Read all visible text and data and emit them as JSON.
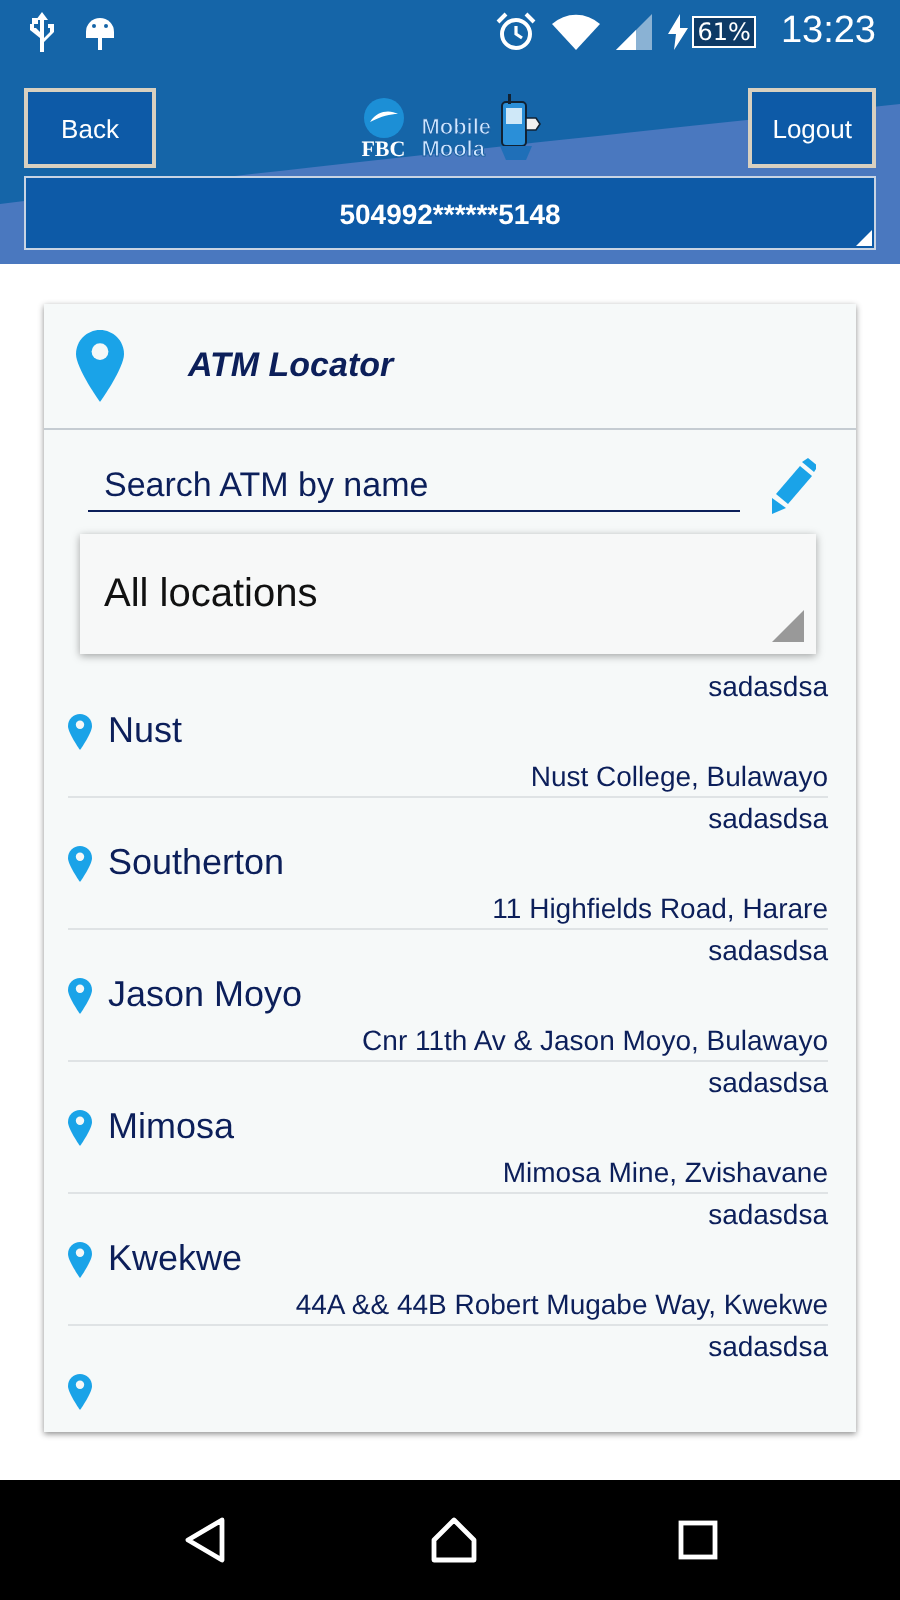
{
  "status_bar": {
    "battery": "61%",
    "time": "13:23"
  },
  "header": {
    "back_button": "Back",
    "logout_button": "Logout",
    "logo": {
      "bank": "FBC",
      "product_line1": "Mobile",
      "product_line2": "Moola"
    },
    "account_number": "504992******5148"
  },
  "panel": {
    "title": "ATM Locator",
    "search": {
      "placeholder": "Search ATM by name"
    },
    "location_filter": "All locations",
    "atms": [
      {
        "kind": "full",
        "note": "sadasdsa",
        "name": "Nust",
        "address": "Nust College, Bulawayo"
      },
      {
        "kind": "full",
        "note": "sadasdsa",
        "name": "Southerton",
        "address": "11 Highfields Road, Harare"
      },
      {
        "kind": "full",
        "note": "sadasdsa",
        "name": "Jason Moyo",
        "address": "Cnr 11th Av & Jason Moyo, Bulawayo"
      },
      {
        "kind": "full",
        "note": "sadasdsa",
        "name": "Mimosa",
        "address": "Mimosa Mine, Zvishavane"
      },
      {
        "kind": "full",
        "note": "sadasdsa",
        "name": "Kwekwe",
        "address": "44A && 44B Robert Mugabe Way, Kwekwe"
      },
      {
        "kind": "partial",
        "note": "sadasdsa"
      }
    ]
  }
}
